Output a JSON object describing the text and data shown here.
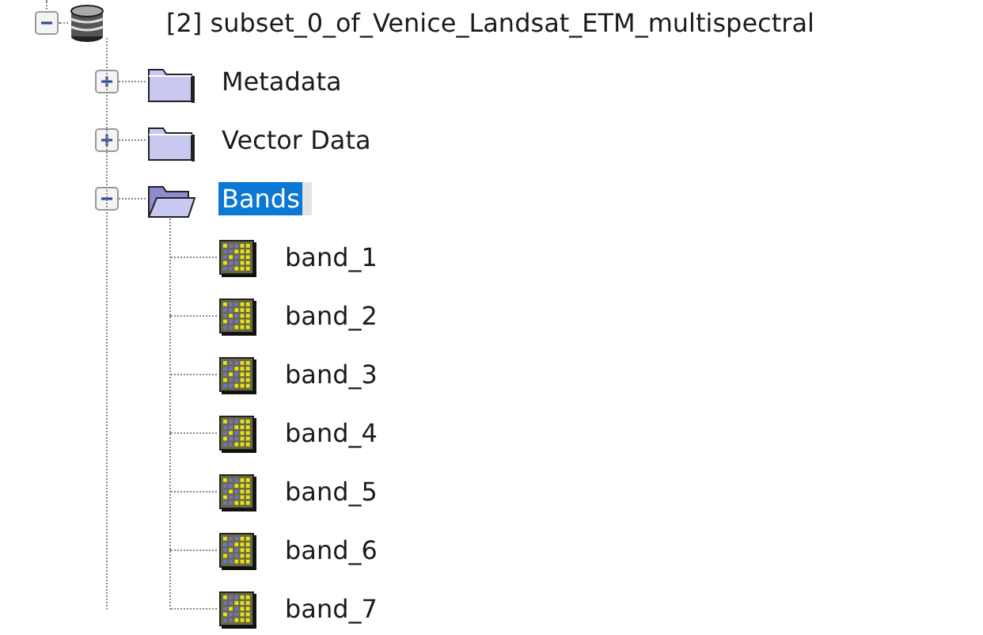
{
  "tree": {
    "label": "[2] subset_0_of_Venice_Landsat_ETM_multispectral",
    "kind": "database",
    "expanded": true,
    "selected": false,
    "children": [
      {
        "label": "Metadata",
        "kind": "folder",
        "expanded": false,
        "selected": false
      },
      {
        "label": "Vector Data",
        "kind": "folder",
        "expanded": false,
        "selected": false
      },
      {
        "label": "Bands",
        "kind": "folder",
        "expanded": true,
        "selected": true,
        "children": [
          {
            "label": "band_1",
            "kind": "band",
            "selected": false
          },
          {
            "label": "band_2",
            "kind": "band",
            "selected": false
          },
          {
            "label": "band_3",
            "kind": "band",
            "selected": false
          },
          {
            "label": "band_4",
            "kind": "band",
            "selected": false
          },
          {
            "label": "band_5",
            "kind": "band",
            "selected": false
          },
          {
            "label": "band_6",
            "kind": "band",
            "selected": false
          },
          {
            "label": "band_7",
            "kind": "band",
            "selected": false
          }
        ]
      }
    ]
  }
}
